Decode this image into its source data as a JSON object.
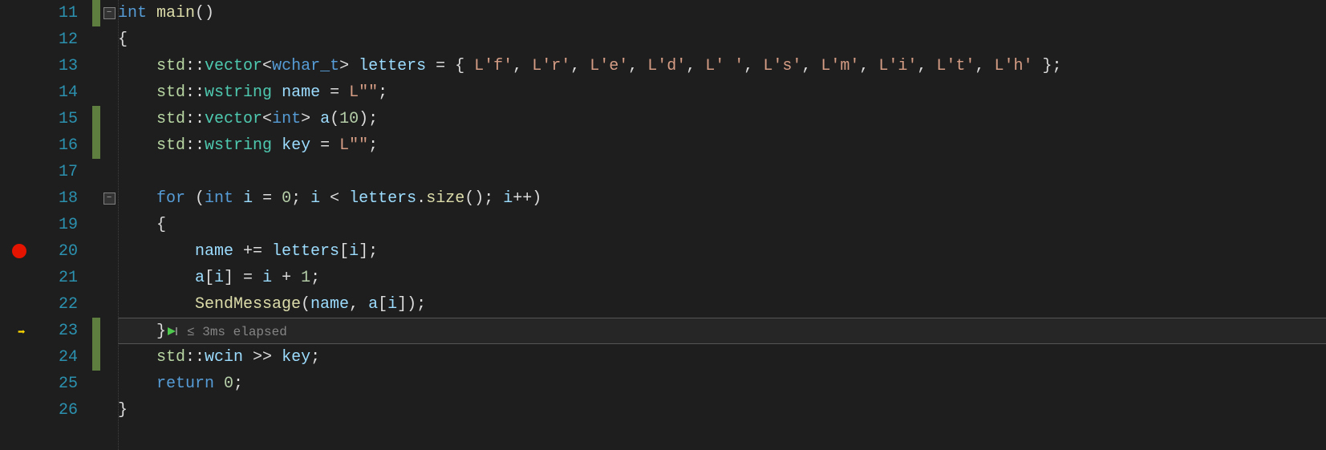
{
  "lines": {
    "start": 11,
    "bp_line": 20,
    "current_line": 23,
    "changed_lines": [
      11,
      15,
      16,
      23,
      24
    ],
    "fold_lines": {
      "11": "minus",
      "18": "minus"
    }
  },
  "code": {
    "l11": {
      "kw_int": "int",
      "fn": "main",
      "paren": "()"
    },
    "l12": {
      "brace": "{"
    },
    "l13": {
      "ns": "std",
      "op": "::",
      "cls": "vector",
      "lt": "<",
      "type": "wchar_t",
      "gt": ">",
      "id": "letters",
      "eq": " = ",
      "init": "{ ",
      "items": [
        "L'f'",
        "L'r'",
        "L'e'",
        "L'd'",
        "L' '",
        "L's'",
        "L'm'",
        "L'i'",
        "L't'",
        "L'h'"
      ],
      "close": " };"
    },
    "l14": {
      "ns": "std",
      "op": "::",
      "cls": "wstring",
      "id": "name",
      "eq": " = ",
      "val": "L\"\"",
      "semi": ";"
    },
    "l15": {
      "ns": "std",
      "op": "::",
      "cls": "vector",
      "lt": "<",
      "type": "int",
      "gt": ">",
      "id": "a",
      "paren": "(",
      "n": "10",
      "close": ");"
    },
    "l16": {
      "ns": "std",
      "op": "::",
      "cls": "wstring",
      "id": "key",
      "eq": " = ",
      "val": "L\"\"",
      "semi": ";"
    },
    "l18": {
      "kw": "for",
      "open": " (",
      "kw2": "int",
      "sp": " ",
      "id": "i",
      "eq": " = ",
      "n0": "0",
      "semi": "; ",
      "id2": "i",
      "lt": " < ",
      "id3": "letters",
      "dot": ".",
      "fn": "size",
      "paren": "()",
      "semi2": "; ",
      "id4": "i",
      "pp": "++)"
    },
    "l19": {
      "brace": "{"
    },
    "l20": {
      "id": "name",
      "op": " += ",
      "id2": "letters",
      "br": "[",
      "id3": "i",
      "close": "];"
    },
    "l21": {
      "id": "a",
      "br": "[",
      "id2": "i",
      "mid": "] = ",
      "id3": "i",
      "plus": " + ",
      "n": "1",
      "semi": ";"
    },
    "l22": {
      "fn": "SendMessage",
      "open": "(",
      "id": "name",
      "comma": ", ",
      "id2": "a",
      "br": "[",
      "id3": "i",
      "close": "]);"
    },
    "l23": {
      "brace": "}",
      "hint": "≤ 3ms elapsed"
    },
    "l24": {
      "ns": "std",
      "op": "::",
      "id": "wcin",
      "shr": " >> ",
      "id2": "key",
      "semi": ";"
    },
    "l25": {
      "kw": "return",
      "sp": " ",
      "n": "0",
      "semi": ";"
    },
    "l26": {
      "brace": "}"
    }
  }
}
